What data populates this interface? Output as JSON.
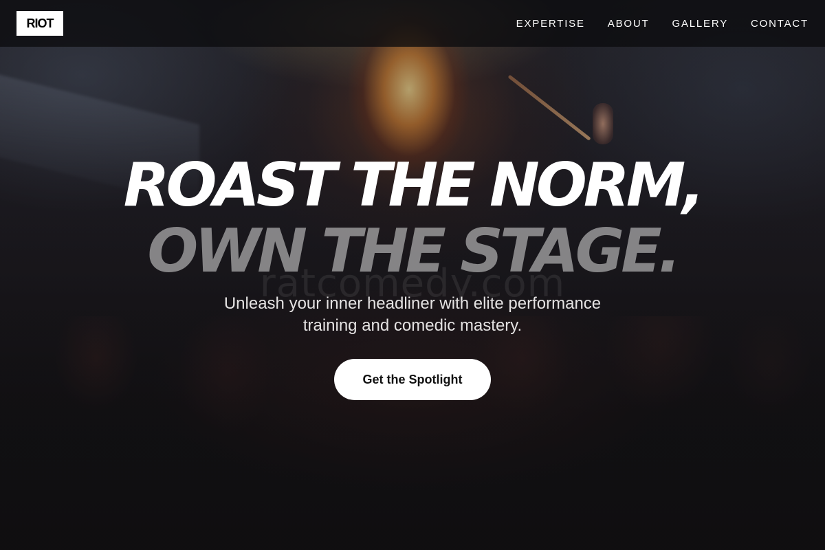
{
  "nav": {
    "logo": "RIOT",
    "links": [
      "EXPERTISE",
      "ABOUT",
      "GALLERY",
      "CONTACT"
    ]
  },
  "hero": {
    "headline_line1": "ROAST THE NORM,",
    "headline_line2": "OWN THE STAGE.",
    "watermark": "ratcomedy.com",
    "subtitle": "Unleash your inner headliner with elite performance training and comedic mastery.",
    "cta_label": "Get the Spotlight"
  },
  "colors": {
    "background": "#121113",
    "text": "#ffffff",
    "button_bg": "#ffffff",
    "button_text": "#111111"
  }
}
